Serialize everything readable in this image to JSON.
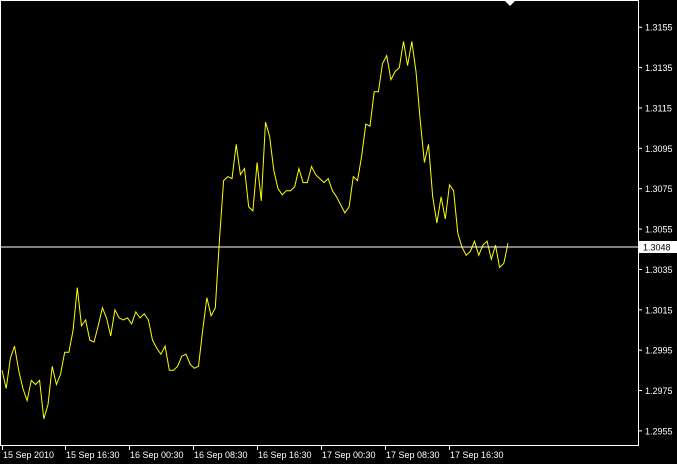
{
  "chart_data": {
    "type": "line",
    "title": "",
    "xlabel": "",
    "ylabel": "",
    "ylim": [
      1.2948,
      1.3168
    ],
    "x_ticks": [
      "15 Sep 2010",
      "15 Sep 16:30",
      "16 Sep 00:30",
      "16 Sep 08:30",
      "16 Sep 16:30",
      "17 Sep 00:30",
      "17 Sep 08:30",
      "17 Sep 16:30"
    ],
    "y_ticks": [
      "1.3155",
      "1.3135",
      "1.3115",
      "1.3095",
      "1.3075",
      "1.3055",
      "1.3035",
      "1.3015",
      "1.2995",
      "1.2975",
      "1.2955"
    ],
    "current_price": "1.3048",
    "grid": false,
    "colors": {
      "background": "#000000",
      "line": "#ffff00",
      "axis": "#ffffff",
      "current_price_line": "#ffffff",
      "current_price_label_bg": "#ffffff",
      "current_price_label_text": "#000000"
    },
    "series": [
      {
        "values": [
          1.2985,
          1.2976,
          1.2991,
          1.2997,
          1.2985,
          1.2976,
          1.297,
          1.298,
          1.2978,
          1.298,
          1.2961,
          1.2968,
          1.2987,
          1.2978,
          1.2983,
          1.2994,
          1.2994,
          1.3005,
          1.3026,
          1.3007,
          1.301,
          1.3,
          1.2999,
          1.3007,
          1.3016,
          1.3011,
          1.3002,
          1.3015,
          1.3011,
          1.301,
          1.3011,
          1.3008,
          1.3014,
          1.3011,
          1.3013,
          1.301,
          1.3,
          1.2996,
          1.2993,
          1.2997,
          1.2985,
          1.2985,
          1.2987,
          1.2992,
          1.2993,
          1.2988,
          1.2986,
          1.2987,
          1.3005,
          1.3021,
          1.3012,
          1.3016,
          1.305,
          1.3079,
          1.3081,
          1.308,
          1.3097,
          1.3082,
          1.3085,
          1.3066,
          1.3064,
          1.3088,
          1.3069,
          1.3108,
          1.3101,
          1.3084,
          1.3075,
          1.3072,
          1.3074,
          1.3074,
          1.3076,
          1.3085,
          1.3078,
          1.3078,
          1.3086,
          1.3082,
          1.308,
          1.3078,
          1.308,
          1.3074,
          1.3071,
          1.3067,
          1.3063,
          1.3066,
          1.3081,
          1.3079,
          1.3091,
          1.3107,
          1.3106,
          1.3123,
          1.3123,
          1.3137,
          1.3141,
          1.3129,
          1.3133,
          1.3135,
          1.3148,
          1.3136,
          1.3148,
          1.3133,
          1.3109,
          1.3088,
          1.3097,
          1.3071,
          1.3058,
          1.3071,
          1.306,
          1.3077,
          1.3074,
          1.3053,
          1.3046,
          1.3042,
          1.3044,
          1.3049,
          1.3042,
          1.3047,
          1.3049,
          1.304,
          1.3047,
          1.3036,
          1.3038,
          1.3048
        ]
      }
    ]
  }
}
